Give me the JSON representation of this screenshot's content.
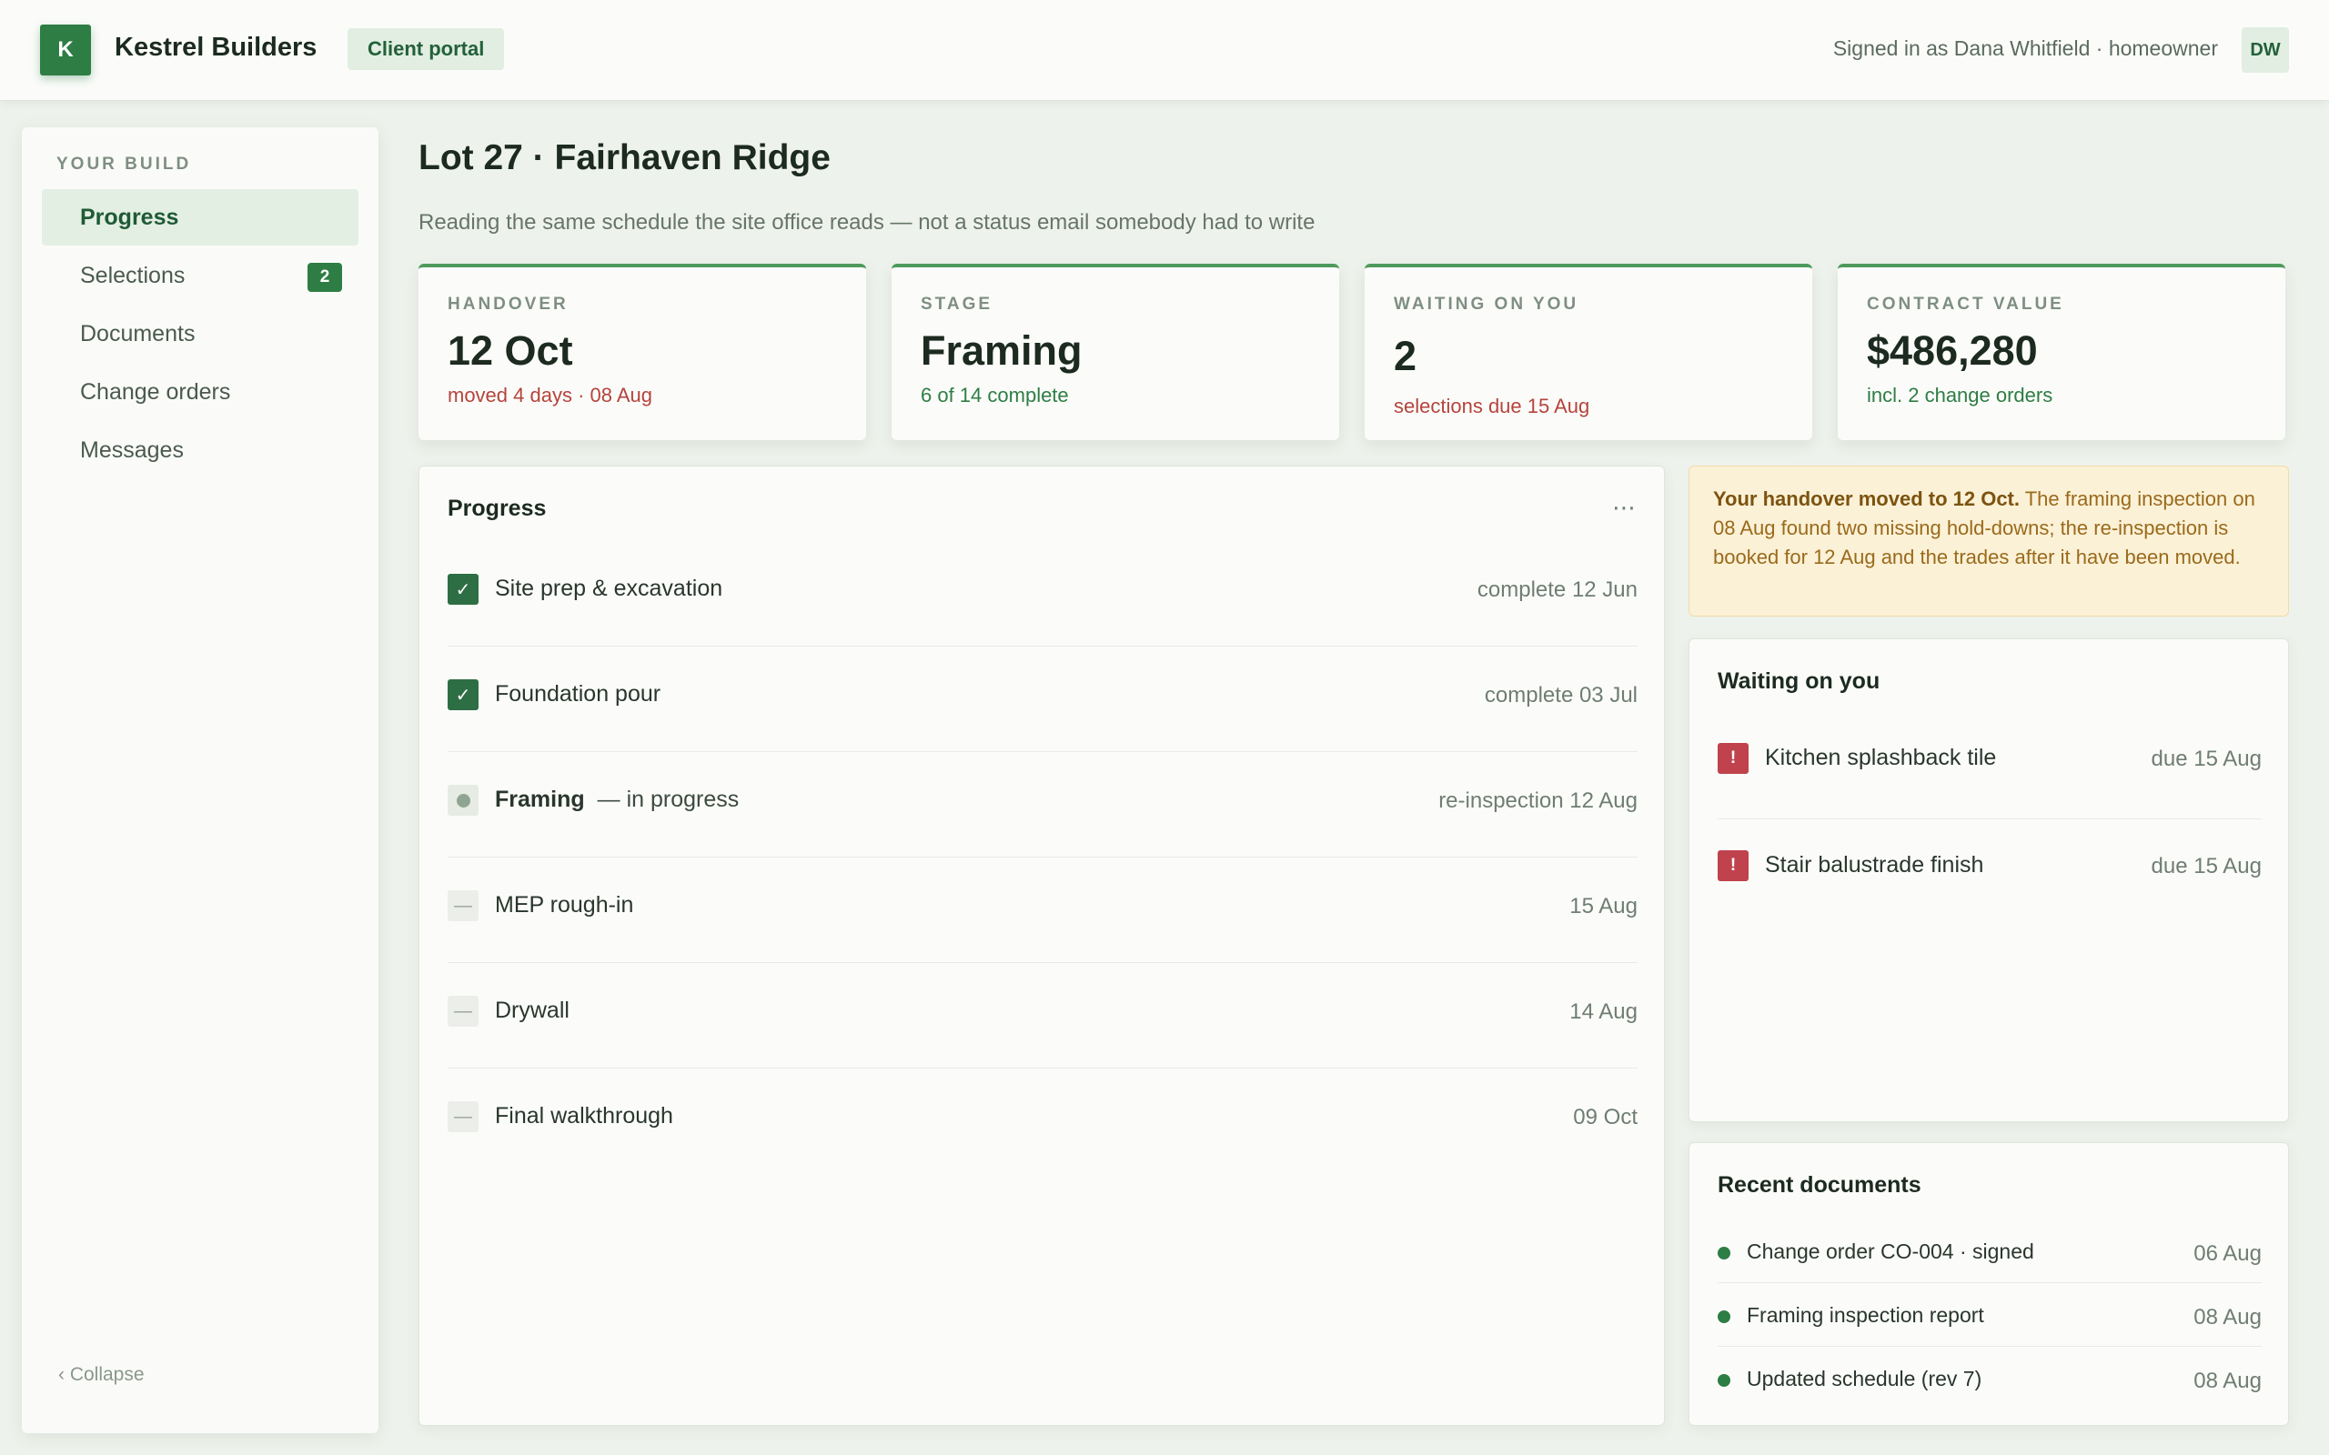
{
  "header": {
    "logo_letter": "K",
    "brand": "Kestrel Builders",
    "portal_label": "Client portal",
    "signed_in": "Signed in as Dana Whitfield · homeowner",
    "avatar_initials": "DW"
  },
  "sidebar": {
    "heading": "YOUR BUILD",
    "items": [
      {
        "label": "Progress",
        "active": true
      },
      {
        "label": "Selections",
        "badge": "2"
      },
      {
        "label": "Documents"
      },
      {
        "label": "Change orders"
      },
      {
        "label": "Messages"
      }
    ],
    "collapse_label": "‹ Collapse"
  },
  "page": {
    "title": "Lot 27 · Fairhaven Ridge",
    "subtitle": "Reading the same schedule the site office reads — not a status email somebody had to write"
  },
  "stats": [
    {
      "label": "HANDOVER",
      "value": "12 Oct",
      "note": "moved 4 days · 08 Aug",
      "note_tone": "red"
    },
    {
      "label": "STAGE",
      "value": "Framing",
      "note": "6 of 14 complete",
      "note_tone": "green"
    },
    {
      "label": "WAITING ON YOU",
      "value": "2",
      "note": "selections due 15 Aug",
      "note_tone": "red"
    },
    {
      "label": "CONTRACT VALUE",
      "value": "$486,280",
      "note": "incl. 2 change orders",
      "note_tone": "green"
    }
  ],
  "progress": {
    "title": "Progress",
    "more_icon": "⋯",
    "rows": [
      {
        "name": "Site prep & excavation",
        "status": "done",
        "date": "complete 12 Jun"
      },
      {
        "name": "Foundation pour",
        "status": "done",
        "date": "complete 03 Jul"
      },
      {
        "name": "Framing",
        "suffix": "— in progress",
        "status": "active",
        "date": "re-inspection 12 Aug"
      },
      {
        "name": "MEP rough-in",
        "status": "pending",
        "date": "15 Aug"
      },
      {
        "name": "Drywall",
        "status": "pending",
        "date": "14 Aug"
      },
      {
        "name": "Final walkthrough",
        "status": "pending",
        "date": "09 Oct"
      }
    ]
  },
  "alert": {
    "bold": "Your handover moved to 12 Oct.",
    "text": " The framing inspection on 08 Aug found two missing hold-downs; the re-inspection is booked for 12 Aug and the trades after it have been moved."
  },
  "waiting": {
    "title": "Waiting on you",
    "items": [
      {
        "name": "Kitchen splashback tile",
        "date": "due 15 Aug"
      },
      {
        "name": "Stair balustrade finish",
        "date": "due 15 Aug"
      }
    ]
  },
  "documents": {
    "title": "Recent documents",
    "items": [
      {
        "name": "Change order CO-004 · signed",
        "date": "06 Aug"
      },
      {
        "name": "Framing inspection report",
        "date": "08 Aug"
      },
      {
        "name": "Updated schedule (rev 7)",
        "date": "08 Aug"
      }
    ]
  }
}
